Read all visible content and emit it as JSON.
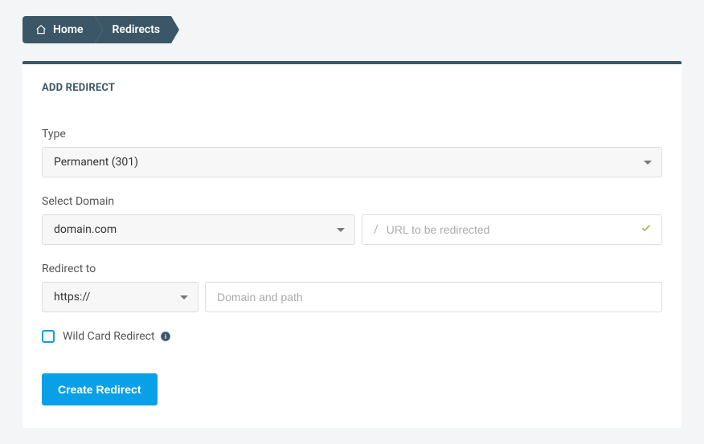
{
  "breadcrumb": {
    "home": "Home",
    "redirects": "Redirects"
  },
  "panel": {
    "title": "ADD REDIRECT"
  },
  "form": {
    "type_label": "Type",
    "type_value": "Permanent (301)",
    "domain_label": "Select Domain",
    "domain_value": "domain.com",
    "url_slash": "/",
    "url_placeholder": "URL to be redirected",
    "redirect_to_label": "Redirect to",
    "protocol_value": "https://",
    "path_placeholder": "Domain and path",
    "wildcard_label": "Wild Card Redirect",
    "submit_label": "Create Redirect"
  }
}
